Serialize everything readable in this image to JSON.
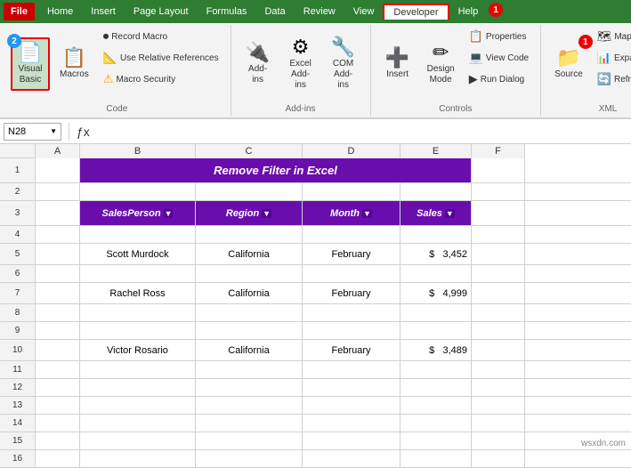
{
  "tabs": [
    {
      "label": "File",
      "id": "file",
      "type": "file"
    },
    {
      "label": "Home",
      "id": "home"
    },
    {
      "label": "Insert",
      "id": "insert"
    },
    {
      "label": "Page Layout",
      "id": "page-layout"
    },
    {
      "label": "Formulas",
      "id": "formulas"
    },
    {
      "label": "Data",
      "id": "data"
    },
    {
      "label": "Review",
      "id": "review"
    },
    {
      "label": "View",
      "id": "view"
    },
    {
      "label": "Developer",
      "id": "developer",
      "active": true,
      "highlighted": true
    },
    {
      "label": "Help",
      "id": "help"
    }
  ],
  "ribbon": {
    "groups": [
      {
        "id": "code",
        "label": "Code",
        "items": [
          {
            "id": "visual-basic",
            "label": "Visual\nBasic",
            "icon": "📄",
            "large": true,
            "badge": "2"
          },
          {
            "id": "macros",
            "label": "Macros",
            "icon": "📋",
            "large": true
          },
          {
            "id": "record-macro",
            "label": "Record Macro",
            "icon": "⏺",
            "small": true
          },
          {
            "id": "use-relative",
            "label": "Use Relative References",
            "icon": "📐",
            "small": true
          },
          {
            "id": "macro-security",
            "label": "Macro Security",
            "icon": "⚠",
            "small": true
          }
        ]
      },
      {
        "id": "add-ins",
        "label": "Add-ins",
        "items": [
          {
            "id": "add-ins-btn",
            "label": "Add-\nins",
            "icon": "🔌",
            "large": true
          },
          {
            "id": "excel-add-ins",
            "label": "Excel\nAdd-ins",
            "icon": "⚙",
            "large": true
          },
          {
            "id": "com-add-ins",
            "label": "COM\nAdd-ins",
            "icon": "🔧",
            "large": true
          }
        ]
      },
      {
        "id": "controls",
        "label": "Controls",
        "items": [
          {
            "id": "insert-btn",
            "label": "Insert",
            "icon": "➕",
            "large": true
          },
          {
            "id": "design-mode",
            "label": "Design\nMode",
            "icon": "✏",
            "large": true
          },
          {
            "id": "properties",
            "label": "Properties",
            "icon": "📋",
            "small": true
          },
          {
            "id": "view-code",
            "label": "View Code",
            "icon": "💻",
            "small": true
          },
          {
            "id": "run-dialog",
            "label": "Run Dialog",
            "icon": "▶",
            "small": true
          }
        ]
      },
      {
        "id": "xml",
        "label": "XML",
        "items": [
          {
            "id": "source-btn",
            "label": "Source",
            "icon": "📁",
            "large": true,
            "badge": "1"
          },
          {
            "id": "refresh-btn",
            "label": "Refresh D...",
            "icon": "🔄",
            "small": true
          },
          {
            "id": "map-props",
            "label": "Map Prop...",
            "icon": "🗺",
            "small": true
          },
          {
            "id": "expansion",
            "label": "Expansion...",
            "icon": "📊",
            "small": true
          }
        ]
      }
    ]
  },
  "formulaBar": {
    "nameBox": "N28",
    "formula": ""
  },
  "columns": [
    {
      "label": "A",
      "width": 50
    },
    {
      "label": "B",
      "width": 130
    },
    {
      "label": "C",
      "width": 120
    },
    {
      "label": "D",
      "width": 110
    },
    {
      "label": "E",
      "width": 80
    },
    {
      "label": "F",
      "width": 60
    }
  ],
  "rows": [
    {
      "num": 1,
      "height": 28,
      "cells": [
        {
          "col": "A",
          "value": ""
        },
        {
          "col": "B",
          "value": "Remove Filter in Excel",
          "type": "title",
          "span": true
        },
        {
          "col": "C",
          "value": ""
        },
        {
          "col": "D",
          "value": ""
        },
        {
          "col": "E",
          "value": ""
        },
        {
          "col": "F",
          "value": ""
        }
      ]
    },
    {
      "num": 2,
      "height": 20,
      "cells": [
        {
          "col": "A",
          "value": ""
        },
        {
          "col": "B",
          "value": ""
        },
        {
          "col": "C",
          "value": ""
        },
        {
          "col": "D",
          "value": ""
        },
        {
          "col": "E",
          "value": ""
        },
        {
          "col": "F",
          "value": ""
        }
      ]
    },
    {
      "num": 3,
      "height": 28,
      "cells": [
        {
          "col": "A",
          "value": ""
        },
        {
          "col": "B",
          "value": "SalesPerson",
          "type": "header"
        },
        {
          "col": "C",
          "value": "Region",
          "type": "header"
        },
        {
          "col": "D",
          "value": "Month",
          "type": "header"
        },
        {
          "col": "E",
          "value": "Sales",
          "type": "header"
        },
        {
          "col": "F",
          "value": ""
        }
      ]
    },
    {
      "num": 4,
      "height": 20,
      "cells": [
        {
          "col": "A",
          "value": ""
        },
        {
          "col": "B",
          "value": ""
        },
        {
          "col": "C",
          "value": ""
        },
        {
          "col": "D",
          "value": ""
        },
        {
          "col": "E",
          "value": ""
        },
        {
          "col": "F",
          "value": ""
        }
      ]
    },
    {
      "num": 5,
      "height": 24,
      "cells": [
        {
          "col": "A",
          "value": ""
        },
        {
          "col": "B",
          "value": "Scott Murdock",
          "type": "data",
          "align": "center"
        },
        {
          "col": "C",
          "value": "California",
          "type": "data",
          "align": "center"
        },
        {
          "col": "D",
          "value": "February",
          "type": "data",
          "align": "center"
        },
        {
          "col": "E",
          "value": "$      3,452",
          "type": "data",
          "align": "right"
        },
        {
          "col": "F",
          "value": ""
        }
      ]
    },
    {
      "num": 6,
      "height": 20,
      "cells": [
        {
          "col": "A",
          "value": ""
        },
        {
          "col": "B",
          "value": ""
        },
        {
          "col": "C",
          "value": ""
        },
        {
          "col": "D",
          "value": ""
        },
        {
          "col": "E",
          "value": ""
        },
        {
          "col": "F",
          "value": ""
        }
      ]
    },
    {
      "num": 7,
      "height": 24,
      "cells": [
        {
          "col": "A",
          "value": ""
        },
        {
          "col": "B",
          "value": "Rachel Ross",
          "type": "data",
          "align": "center"
        },
        {
          "col": "C",
          "value": "California",
          "type": "data",
          "align": "center"
        },
        {
          "col": "D",
          "value": "February",
          "type": "data",
          "align": "center"
        },
        {
          "col": "E",
          "value": "$      4,999",
          "type": "data",
          "align": "right"
        },
        {
          "col": "F",
          "value": ""
        }
      ]
    },
    {
      "num": 8,
      "height": 20,
      "cells": [
        {
          "col": "A",
          "value": ""
        },
        {
          "col": "B",
          "value": ""
        },
        {
          "col": "C",
          "value": ""
        },
        {
          "col": "D",
          "value": ""
        },
        {
          "col": "E",
          "value": ""
        },
        {
          "col": "F",
          "value": ""
        }
      ]
    },
    {
      "num": 9,
      "height": 20,
      "cells": [
        {
          "col": "A",
          "value": ""
        },
        {
          "col": "B",
          "value": ""
        },
        {
          "col": "C",
          "value": ""
        },
        {
          "col": "D",
          "value": ""
        },
        {
          "col": "E",
          "value": ""
        },
        {
          "col": "F",
          "value": ""
        }
      ]
    },
    {
      "num": 10,
      "height": 24,
      "cells": [
        {
          "col": "A",
          "value": ""
        },
        {
          "col": "B",
          "value": "Victor Rosario",
          "type": "data",
          "align": "center"
        },
        {
          "col": "C",
          "value": "California",
          "type": "data",
          "align": "center"
        },
        {
          "col": "D",
          "value": "February",
          "type": "data",
          "align": "center"
        },
        {
          "col": "E",
          "value": "$      3,489",
          "type": "data",
          "align": "right"
        },
        {
          "col": "F",
          "value": ""
        }
      ]
    },
    {
      "num": 11,
      "height": 20
    },
    {
      "num": 12,
      "height": 20
    },
    {
      "num": 13,
      "height": 20
    },
    {
      "num": 14,
      "height": 20
    },
    {
      "num": 15,
      "height": 20
    },
    {
      "num": 16,
      "height": 20
    }
  ],
  "watermark": "wsxdn.com"
}
